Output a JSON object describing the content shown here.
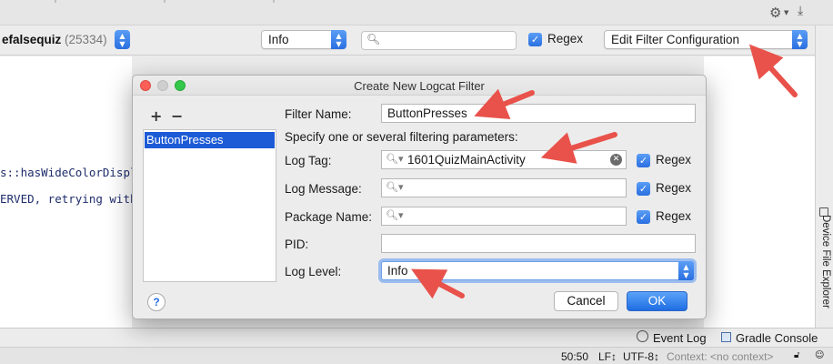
{
  "ide": {
    "process": {
      "name": "efalsequiz",
      "pid": "(25334)"
    },
    "log_level": "Info",
    "search_placeholder": "",
    "regex_label": "Regex",
    "filter_config": "Edit Filter Configuration",
    "code_lines": [
      "s::hasWideColorDispla",
      "ERVED, retrying witho"
    ],
    "side_tab": "Device File Explorer",
    "tool_windows": {
      "event_log": "Event Log",
      "gradle_console": "Gradle Console"
    },
    "status": {
      "position": "50:50",
      "line_sep": "LF↕",
      "encoding": "UTF-8↕",
      "context": "Context: <no context>"
    }
  },
  "dialog": {
    "title": "Create New Logcat Filter",
    "list_items": [
      "ButtonPresses"
    ],
    "filter_name_label": "Filter Name:",
    "filter_name": "ButtonPresses",
    "hint": "Specify one or several filtering parameters:",
    "log_tag_label": "Log Tag:",
    "log_tag": "1601QuizMainActivity",
    "log_message_label": "Log Message:",
    "package_name_label": "Package Name:",
    "pid_label": "PID:",
    "log_level_label": "Log Level:",
    "log_level": "Info",
    "regex_label": "Regex",
    "cancel": "Cancel",
    "ok": "OK"
  },
  "colors": {
    "accent": "#2a6fe0",
    "annotation_arrow": "#e8524a",
    "selection": "#1d5bd6"
  }
}
